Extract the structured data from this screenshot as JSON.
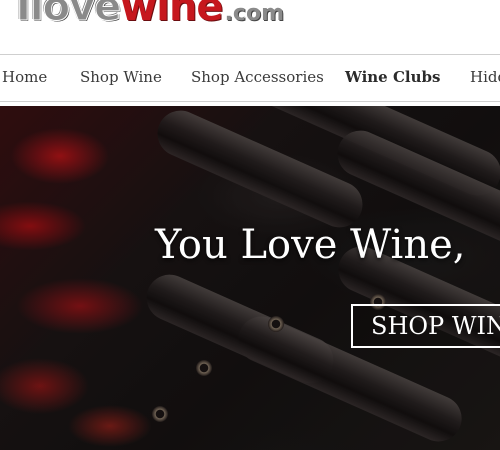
{
  "logo": {
    "part1": "Ilove",
    "part2": "wine",
    "part3": ".com"
  },
  "nav": {
    "items": [
      {
        "label": "Home"
      },
      {
        "label": "Shop Wine"
      },
      {
        "label": "Shop Accessories"
      },
      {
        "label": "Wine Clubs"
      },
      {
        "label": "Hidd"
      }
    ]
  },
  "hero": {
    "title": "You Love Wine,",
    "button_label": "SHOP WIN"
  }
}
